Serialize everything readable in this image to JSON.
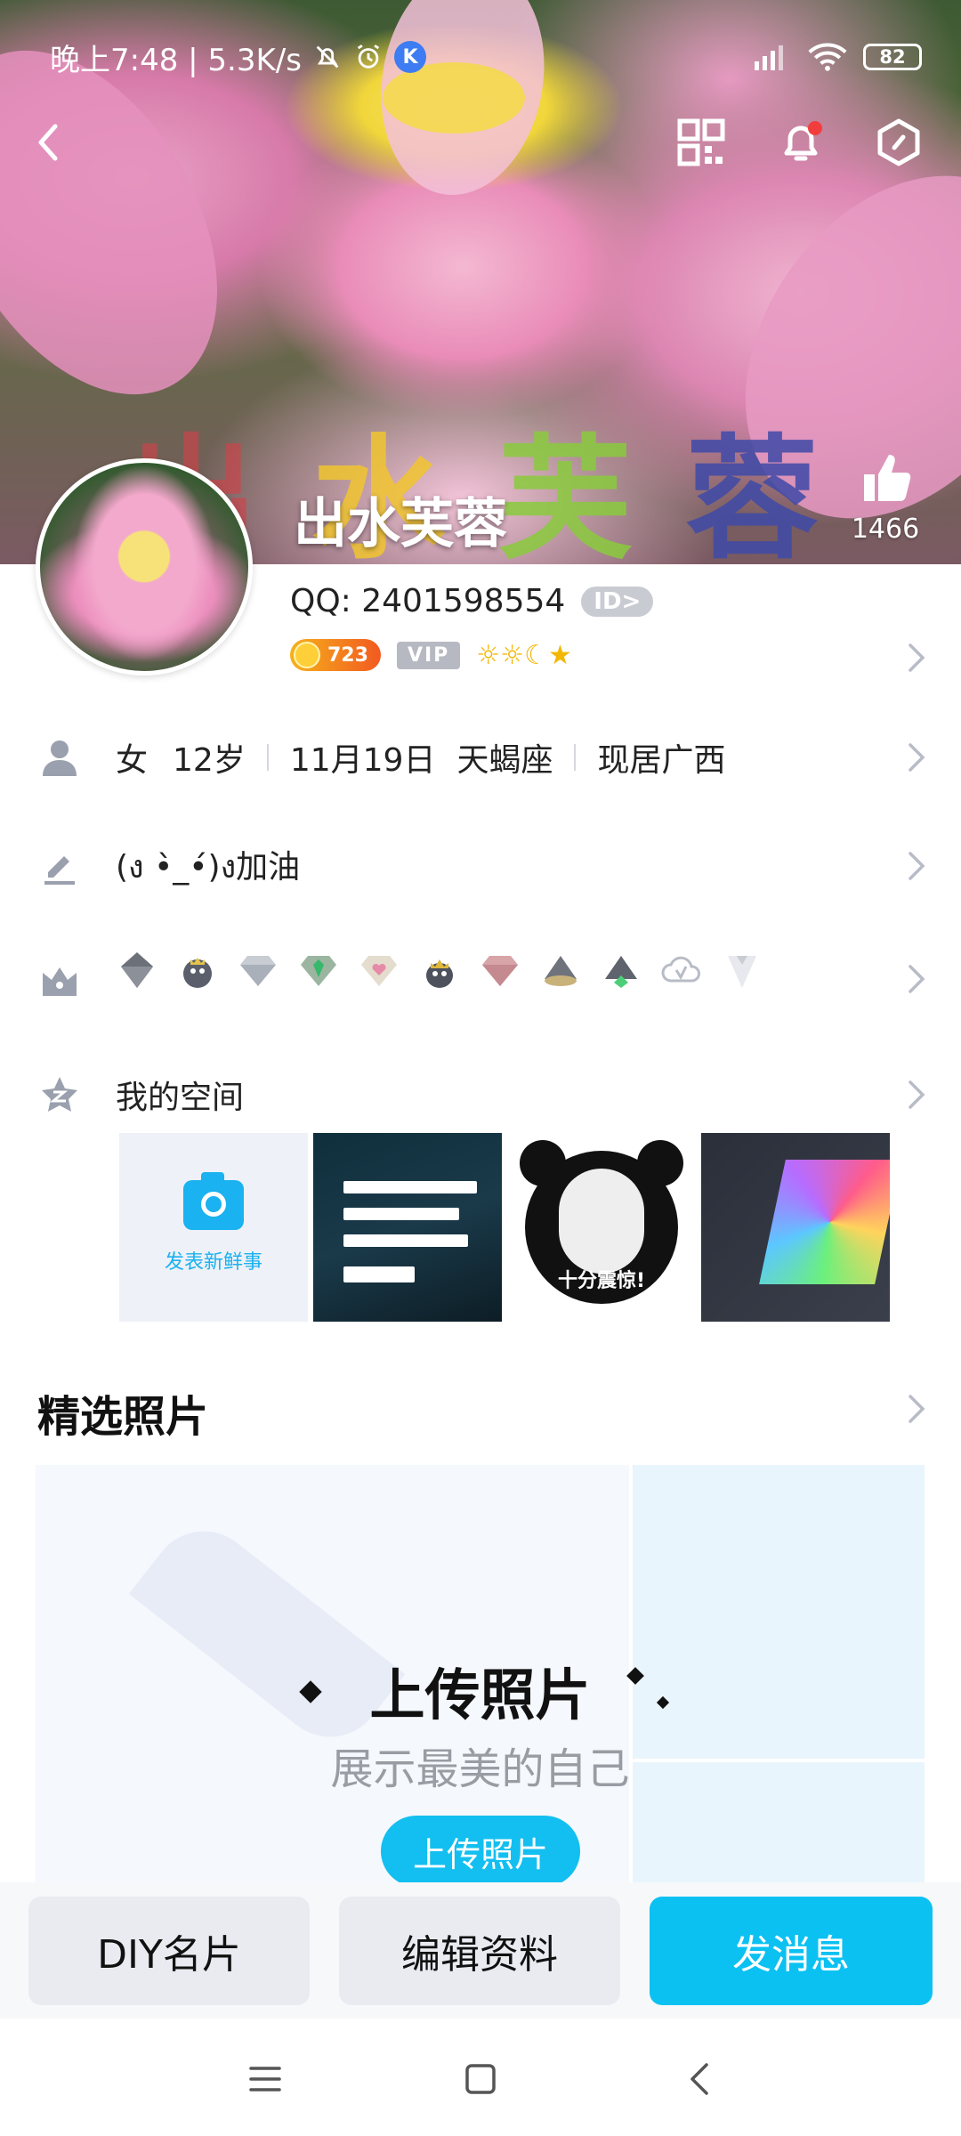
{
  "status_bar": {
    "time_speed": "晚上7:48 | 5.3K/s",
    "k_badge": "K",
    "battery": "82"
  },
  "profile": {
    "nickname": "出水芙蓉",
    "cover_text": "出水芙蓉",
    "likes": "1466",
    "qq_label": "QQ: 2401598554",
    "id_badge": "ID>",
    "coin_level": "723",
    "vip_label": "VIP",
    "level_icons": "☼☼☾★"
  },
  "info": {
    "gender": "女",
    "age": "12岁",
    "birthday": "11月19日",
    "constellation": "天蝎座",
    "location": "现居广西",
    "signature": "(ง •̀_•́)ง加油"
  },
  "qzone": {
    "label": "我的空间",
    "post_label": "发表新鲜事",
    "meme_caption": "十分震惊!"
  },
  "photos": {
    "section_title": "精选照片",
    "upload_heading": "上传照片",
    "upload_sub": "展示最美的自己",
    "upload_button": "上传照片"
  },
  "actions": {
    "diy": "DIY名片",
    "edit": "编辑资料",
    "message": "发消息"
  },
  "colors": {
    "accent": "#0bc1f2",
    "chevron": "#b8bcc6"
  }
}
